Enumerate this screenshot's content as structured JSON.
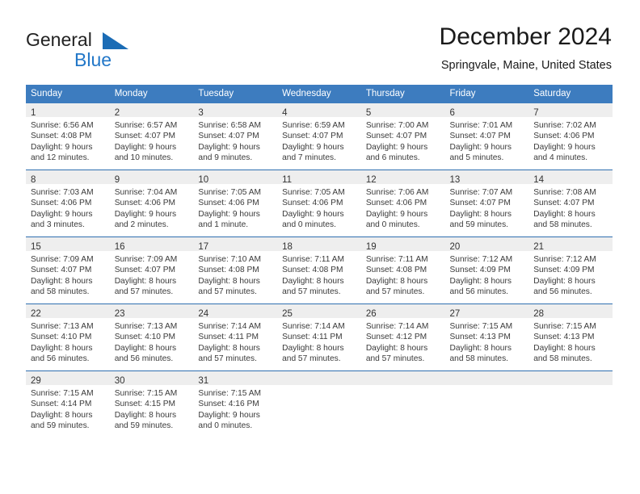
{
  "brand": {
    "name_part1": "General",
    "name_part2": "Blue",
    "triangle_color": "#1b6cb5",
    "blue_color": "#2277c8"
  },
  "header": {
    "title": "December 2024",
    "subtitle": "Springvale, Maine, United States"
  },
  "theme": {
    "header_row_bg": "#3d7cbf",
    "row_divider": "#2f6fb0",
    "daynum_band_bg": "#eeeeee"
  },
  "weekdays": [
    "Sunday",
    "Monday",
    "Tuesday",
    "Wednesday",
    "Thursday",
    "Friday",
    "Saturday"
  ],
  "weeks": [
    [
      {
        "day": "1",
        "sunrise": "Sunrise: 6:56 AM",
        "sunset": "Sunset: 4:08 PM",
        "daylight1": "Daylight: 9 hours",
        "daylight2": "and 12 minutes."
      },
      {
        "day": "2",
        "sunrise": "Sunrise: 6:57 AM",
        "sunset": "Sunset: 4:07 PM",
        "daylight1": "Daylight: 9 hours",
        "daylight2": "and 10 minutes."
      },
      {
        "day": "3",
        "sunrise": "Sunrise: 6:58 AM",
        "sunset": "Sunset: 4:07 PM",
        "daylight1": "Daylight: 9 hours",
        "daylight2": "and 9 minutes."
      },
      {
        "day": "4",
        "sunrise": "Sunrise: 6:59 AM",
        "sunset": "Sunset: 4:07 PM",
        "daylight1": "Daylight: 9 hours",
        "daylight2": "and 7 minutes."
      },
      {
        "day": "5",
        "sunrise": "Sunrise: 7:00 AM",
        "sunset": "Sunset: 4:07 PM",
        "daylight1": "Daylight: 9 hours",
        "daylight2": "and 6 minutes."
      },
      {
        "day": "6",
        "sunrise": "Sunrise: 7:01 AM",
        "sunset": "Sunset: 4:07 PM",
        "daylight1": "Daylight: 9 hours",
        "daylight2": "and 5 minutes."
      },
      {
        "day": "7",
        "sunrise": "Sunrise: 7:02 AM",
        "sunset": "Sunset: 4:06 PM",
        "daylight1": "Daylight: 9 hours",
        "daylight2": "and 4 minutes."
      }
    ],
    [
      {
        "day": "8",
        "sunrise": "Sunrise: 7:03 AM",
        "sunset": "Sunset: 4:06 PM",
        "daylight1": "Daylight: 9 hours",
        "daylight2": "and 3 minutes."
      },
      {
        "day": "9",
        "sunrise": "Sunrise: 7:04 AM",
        "sunset": "Sunset: 4:06 PM",
        "daylight1": "Daylight: 9 hours",
        "daylight2": "and 2 minutes."
      },
      {
        "day": "10",
        "sunrise": "Sunrise: 7:05 AM",
        "sunset": "Sunset: 4:06 PM",
        "daylight1": "Daylight: 9 hours",
        "daylight2": "and 1 minute."
      },
      {
        "day": "11",
        "sunrise": "Sunrise: 7:05 AM",
        "sunset": "Sunset: 4:06 PM",
        "daylight1": "Daylight: 9 hours",
        "daylight2": "and 0 minutes."
      },
      {
        "day": "12",
        "sunrise": "Sunrise: 7:06 AM",
        "sunset": "Sunset: 4:06 PM",
        "daylight1": "Daylight: 9 hours",
        "daylight2": "and 0 minutes."
      },
      {
        "day": "13",
        "sunrise": "Sunrise: 7:07 AM",
        "sunset": "Sunset: 4:07 PM",
        "daylight1": "Daylight: 8 hours",
        "daylight2": "and 59 minutes."
      },
      {
        "day": "14",
        "sunrise": "Sunrise: 7:08 AM",
        "sunset": "Sunset: 4:07 PM",
        "daylight1": "Daylight: 8 hours",
        "daylight2": "and 58 minutes."
      }
    ],
    [
      {
        "day": "15",
        "sunrise": "Sunrise: 7:09 AM",
        "sunset": "Sunset: 4:07 PM",
        "daylight1": "Daylight: 8 hours",
        "daylight2": "and 58 minutes."
      },
      {
        "day": "16",
        "sunrise": "Sunrise: 7:09 AM",
        "sunset": "Sunset: 4:07 PM",
        "daylight1": "Daylight: 8 hours",
        "daylight2": "and 57 minutes."
      },
      {
        "day": "17",
        "sunrise": "Sunrise: 7:10 AM",
        "sunset": "Sunset: 4:08 PM",
        "daylight1": "Daylight: 8 hours",
        "daylight2": "and 57 minutes."
      },
      {
        "day": "18",
        "sunrise": "Sunrise: 7:11 AM",
        "sunset": "Sunset: 4:08 PM",
        "daylight1": "Daylight: 8 hours",
        "daylight2": "and 57 minutes."
      },
      {
        "day": "19",
        "sunrise": "Sunrise: 7:11 AM",
        "sunset": "Sunset: 4:08 PM",
        "daylight1": "Daylight: 8 hours",
        "daylight2": "and 57 minutes."
      },
      {
        "day": "20",
        "sunrise": "Sunrise: 7:12 AM",
        "sunset": "Sunset: 4:09 PM",
        "daylight1": "Daylight: 8 hours",
        "daylight2": "and 56 minutes."
      },
      {
        "day": "21",
        "sunrise": "Sunrise: 7:12 AM",
        "sunset": "Sunset: 4:09 PM",
        "daylight1": "Daylight: 8 hours",
        "daylight2": "and 56 minutes."
      }
    ],
    [
      {
        "day": "22",
        "sunrise": "Sunrise: 7:13 AM",
        "sunset": "Sunset: 4:10 PM",
        "daylight1": "Daylight: 8 hours",
        "daylight2": "and 56 minutes."
      },
      {
        "day": "23",
        "sunrise": "Sunrise: 7:13 AM",
        "sunset": "Sunset: 4:10 PM",
        "daylight1": "Daylight: 8 hours",
        "daylight2": "and 56 minutes."
      },
      {
        "day": "24",
        "sunrise": "Sunrise: 7:14 AM",
        "sunset": "Sunset: 4:11 PM",
        "daylight1": "Daylight: 8 hours",
        "daylight2": "and 57 minutes."
      },
      {
        "day": "25",
        "sunrise": "Sunrise: 7:14 AM",
        "sunset": "Sunset: 4:11 PM",
        "daylight1": "Daylight: 8 hours",
        "daylight2": "and 57 minutes."
      },
      {
        "day": "26",
        "sunrise": "Sunrise: 7:14 AM",
        "sunset": "Sunset: 4:12 PM",
        "daylight1": "Daylight: 8 hours",
        "daylight2": "and 57 minutes."
      },
      {
        "day": "27",
        "sunrise": "Sunrise: 7:15 AM",
        "sunset": "Sunset: 4:13 PM",
        "daylight1": "Daylight: 8 hours",
        "daylight2": "and 58 minutes."
      },
      {
        "day": "28",
        "sunrise": "Sunrise: 7:15 AM",
        "sunset": "Sunset: 4:13 PM",
        "daylight1": "Daylight: 8 hours",
        "daylight2": "and 58 minutes."
      }
    ],
    [
      {
        "day": "29",
        "sunrise": "Sunrise: 7:15 AM",
        "sunset": "Sunset: 4:14 PM",
        "daylight1": "Daylight: 8 hours",
        "daylight2": "and 59 minutes."
      },
      {
        "day": "30",
        "sunrise": "Sunrise: 7:15 AM",
        "sunset": "Sunset: 4:15 PM",
        "daylight1": "Daylight: 8 hours",
        "daylight2": "and 59 minutes."
      },
      {
        "day": "31",
        "sunrise": "Sunrise: 7:15 AM",
        "sunset": "Sunset: 4:16 PM",
        "daylight1": "Daylight: 9 hours",
        "daylight2": "and 0 minutes."
      },
      {
        "day": "",
        "sunrise": "",
        "sunset": "",
        "daylight1": "",
        "daylight2": ""
      },
      {
        "day": "",
        "sunrise": "",
        "sunset": "",
        "daylight1": "",
        "daylight2": ""
      },
      {
        "day": "",
        "sunrise": "",
        "sunset": "",
        "daylight1": "",
        "daylight2": ""
      },
      {
        "day": "",
        "sunrise": "",
        "sunset": "",
        "daylight1": "",
        "daylight2": ""
      }
    ]
  ]
}
